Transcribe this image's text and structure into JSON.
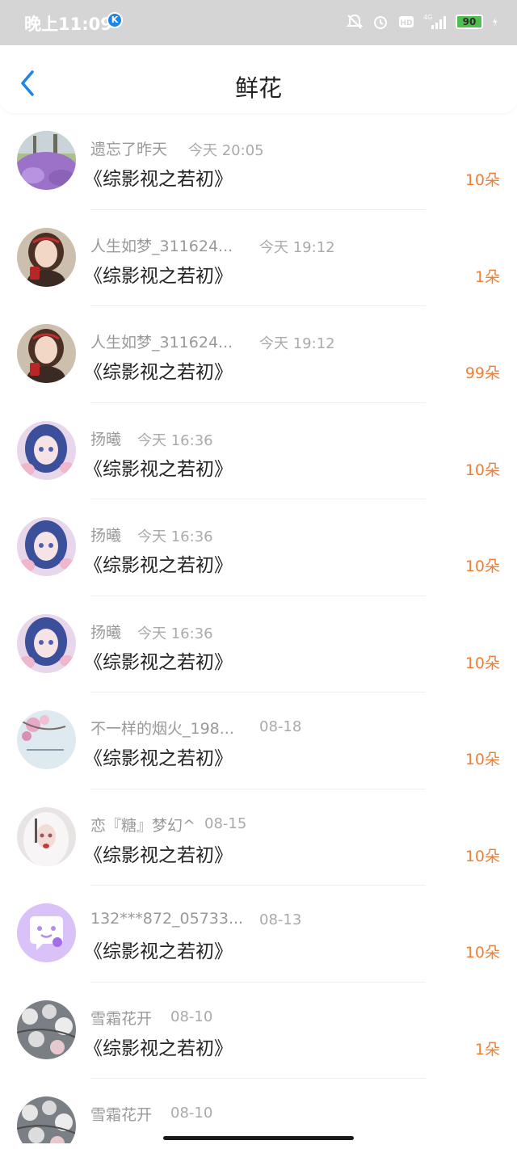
{
  "status_bar": {
    "time": "晚上11:09",
    "app_badge": "K",
    "signal": "4G",
    "battery": "90"
  },
  "header": {
    "title": "鲜花"
  },
  "items": [
    {
      "name": "遗忘了昨天",
      "time": "今天 20:05",
      "book": "《综影视之若初》",
      "amount": "10朵",
      "avatar": "flower-field-avatar"
    },
    {
      "name": "人生如梦_311624...",
      "time": "今天 19:12",
      "book": "《综影视之若初》",
      "amount": "1朵",
      "avatar": "girl-portrait-avatar"
    },
    {
      "name": "人生如梦_311624...",
      "time": "今天 19:12",
      "book": "《综影视之若初》",
      "amount": "99朵",
      "avatar": "girl-portrait-avatar"
    },
    {
      "name": "扬曦",
      "time": "今天 16:36",
      "book": "《综影视之若初》",
      "amount": "10朵",
      "avatar": "anime-girl-avatar"
    },
    {
      "name": "扬曦",
      "time": "今天 16:36",
      "book": "《综影视之若初》",
      "amount": "10朵",
      "avatar": "anime-girl-avatar"
    },
    {
      "name": "扬曦",
      "time": "今天 16:36",
      "book": "《综影视之若初》",
      "amount": "10朵",
      "avatar": "anime-girl-avatar"
    },
    {
      "name": "不一样的烟火_198...",
      "time": "08-18",
      "book": "《综影视之若初》",
      "amount": "10朵",
      "avatar": "blossom-avatar"
    },
    {
      "name": "恋『糖』梦幻^",
      "time": "08-15",
      "book": "《综影视之若初》",
      "amount": "10朵",
      "avatar": "white-hair-girl-avatar"
    },
    {
      "name": "132***872_05733...",
      "time": "08-13",
      "book": "《综影视之若初》",
      "amount": "10朵",
      "avatar": "default-chat-avatar"
    },
    {
      "name": "雪霜花开",
      "time": "08-10",
      "book": "《综影视之若初》",
      "amount": "1朵",
      "avatar": "snow-blossom-avatar"
    },
    {
      "name": "雪霜花开",
      "time": "08-10",
      "book": "",
      "amount": "",
      "avatar": "snow-blossom-avatar"
    }
  ],
  "colors": {
    "accent": "#ef8037",
    "back_arrow": "#1d86e5",
    "status_bar_bg": "#d5d5d5"
  }
}
